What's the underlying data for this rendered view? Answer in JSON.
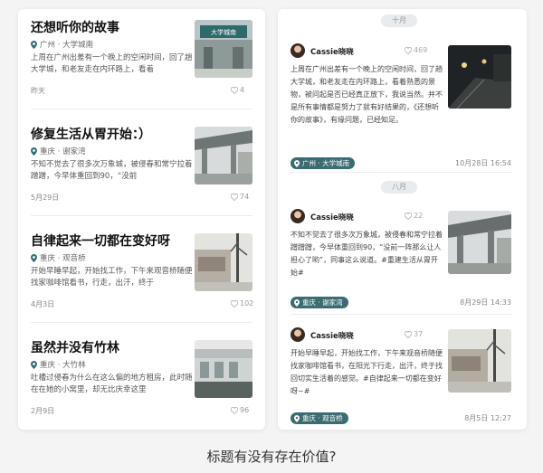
{
  "left_cards": [
    {
      "title": "还想听你的故事",
      "location": "广州 · 大学城南",
      "desc": "上周在广州出差有一个晚上的空闲时间，回了趟大学城，和老友走在内环路上，看着",
      "date": "昨天",
      "likes": "4",
      "thumb": "大学城南"
    },
    {
      "title": "修复生活从胃开始：）",
      "location": "重庆 · 谢家湾",
      "desc": "不知不觉去了很多次万象城，被侵春和常宁拉着蹭蹭，今早体重回到90，“没前",
      "date": "5月29日",
      "likes": "74"
    },
    {
      "title": "自律起来一切都在变好呀",
      "location": "重庆 · 观音桥",
      "desc": "开始早睡早起，开始找工作，下午来观音桥随便找家咖啡馆看书，行走，出汗，终于",
      "date": "4月3日",
      "likes": "102"
    },
    {
      "title": "虽然并没有竹林",
      "location": "重庆 · 大竹林",
      "desc": "吐槽过侵春为什么在这么偏的地方租房，此时随在在她的小窝里，却无比庆幸这里",
      "date": "2月9日",
      "likes": "96"
    }
  ],
  "months": [
    "十月",
    "八月"
  ],
  "posts": [
    {
      "user": "Cassie晓晓",
      "likes": "469",
      "text": "上周在广州出差有一个晚上的空闲时间，回了趟大学城，和老友走在内环路上，看着熟悉的景物，被问起是否已经真正放下，我说当然。并不是所有事情都是努力了就有好结果的，《还想听你的故事》，有缘问题，已经知足。",
      "tag": "广州 · 大学城南",
      "date": "10月28日 16:54"
    },
    {
      "user": "Cassie晓晓",
      "likes": "22",
      "text": "不知不觉去了很多次万象城，被侵春和常宁拉着蹭蹭蹭，今早体重回到90，“没前一阵那么让人担心了哟”，同事这么说道。#重建生活从胃开始#",
      "tag": "重庆 · 谢家湾",
      "date": "8月29日 14:33"
    },
    {
      "user": "Cassie晓晓",
      "likes": "37",
      "text": "开始早睡早起，开始找工作，下午来观音桥随便找家咖啡馆看书，在阳光下行走，出汗，终于找回切实生活着的感觉。#自律起来一切都在变好呀~#",
      "tag": "重庆 · 观音桥",
      "date": "8月5日 12:27"
    }
  ],
  "caption": "标题有没有存在价值?"
}
